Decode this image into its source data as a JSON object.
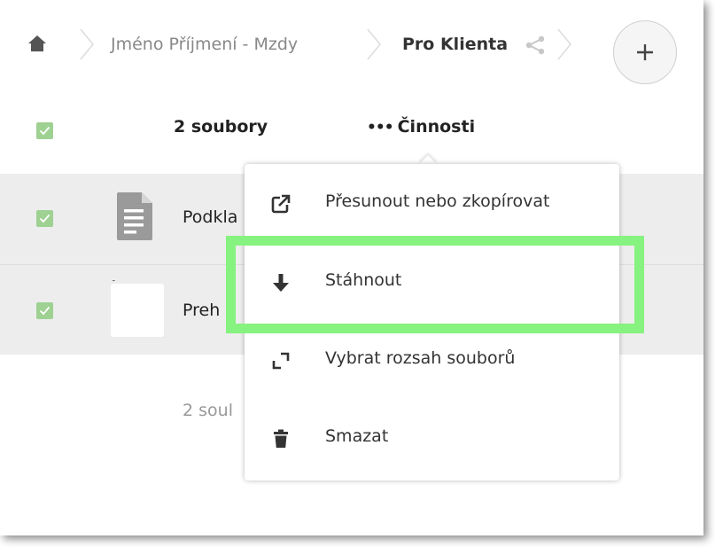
{
  "breadcrumb": {
    "home_icon": "home-icon",
    "items": [
      "Jméno Příjmení - Mzdy",
      "Pro Klienta"
    ],
    "share_icon": "share-icon",
    "add_icon": "plus-icon"
  },
  "list_header": {
    "selected_count": "2 soubory",
    "actions_label": "Činnosti",
    "actions_icon": "•••"
  },
  "files": [
    {
      "name": "Podkla",
      "icon": "document-icon",
      "checked": true
    },
    {
      "name": "Preh e",
      "icon": "thumbnail",
      "checked": true
    }
  ],
  "footer": {
    "summary": "2 soul"
  },
  "menu": {
    "items": [
      {
        "label": "Přesunout nebo zkopírovat",
        "icon": "external-link-icon"
      },
      {
        "label": "Stáhnout",
        "icon": "download-icon"
      },
      {
        "label": "Vybrat rozsah souborů",
        "icon": "range-select-icon"
      },
      {
        "label": "Smazat",
        "icon": "trash-icon"
      }
    ],
    "highlighted_item": "Stáhnout"
  },
  "colors": {
    "checkbox": "#9ed192",
    "highlight_border": "#86f27f",
    "selected_row_bg": "#ededed"
  }
}
